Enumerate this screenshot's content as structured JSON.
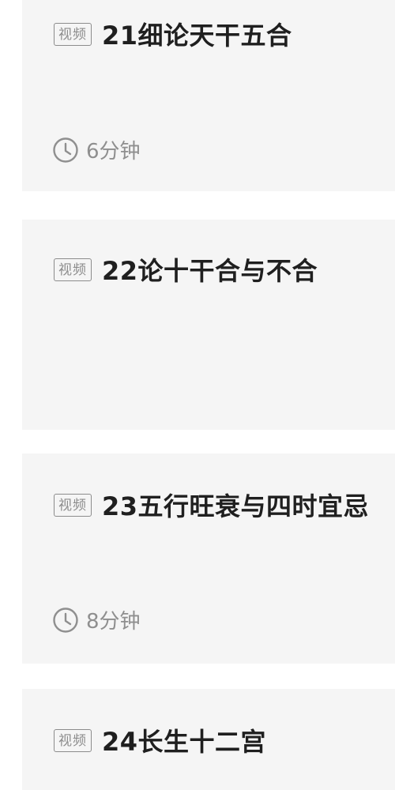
{
  "courses": [
    {
      "badge": "视频",
      "title": "21细论天干五合",
      "duration": "6分钟"
    },
    {
      "badge": "视频",
      "title": "22论十干合与不合",
      "duration": ""
    },
    {
      "badge": "视频",
      "title": "23五行旺衰与四时宜忌",
      "duration": "8分钟"
    },
    {
      "badge": "视频",
      "title": "24长生十二宫",
      "duration": ""
    }
  ]
}
